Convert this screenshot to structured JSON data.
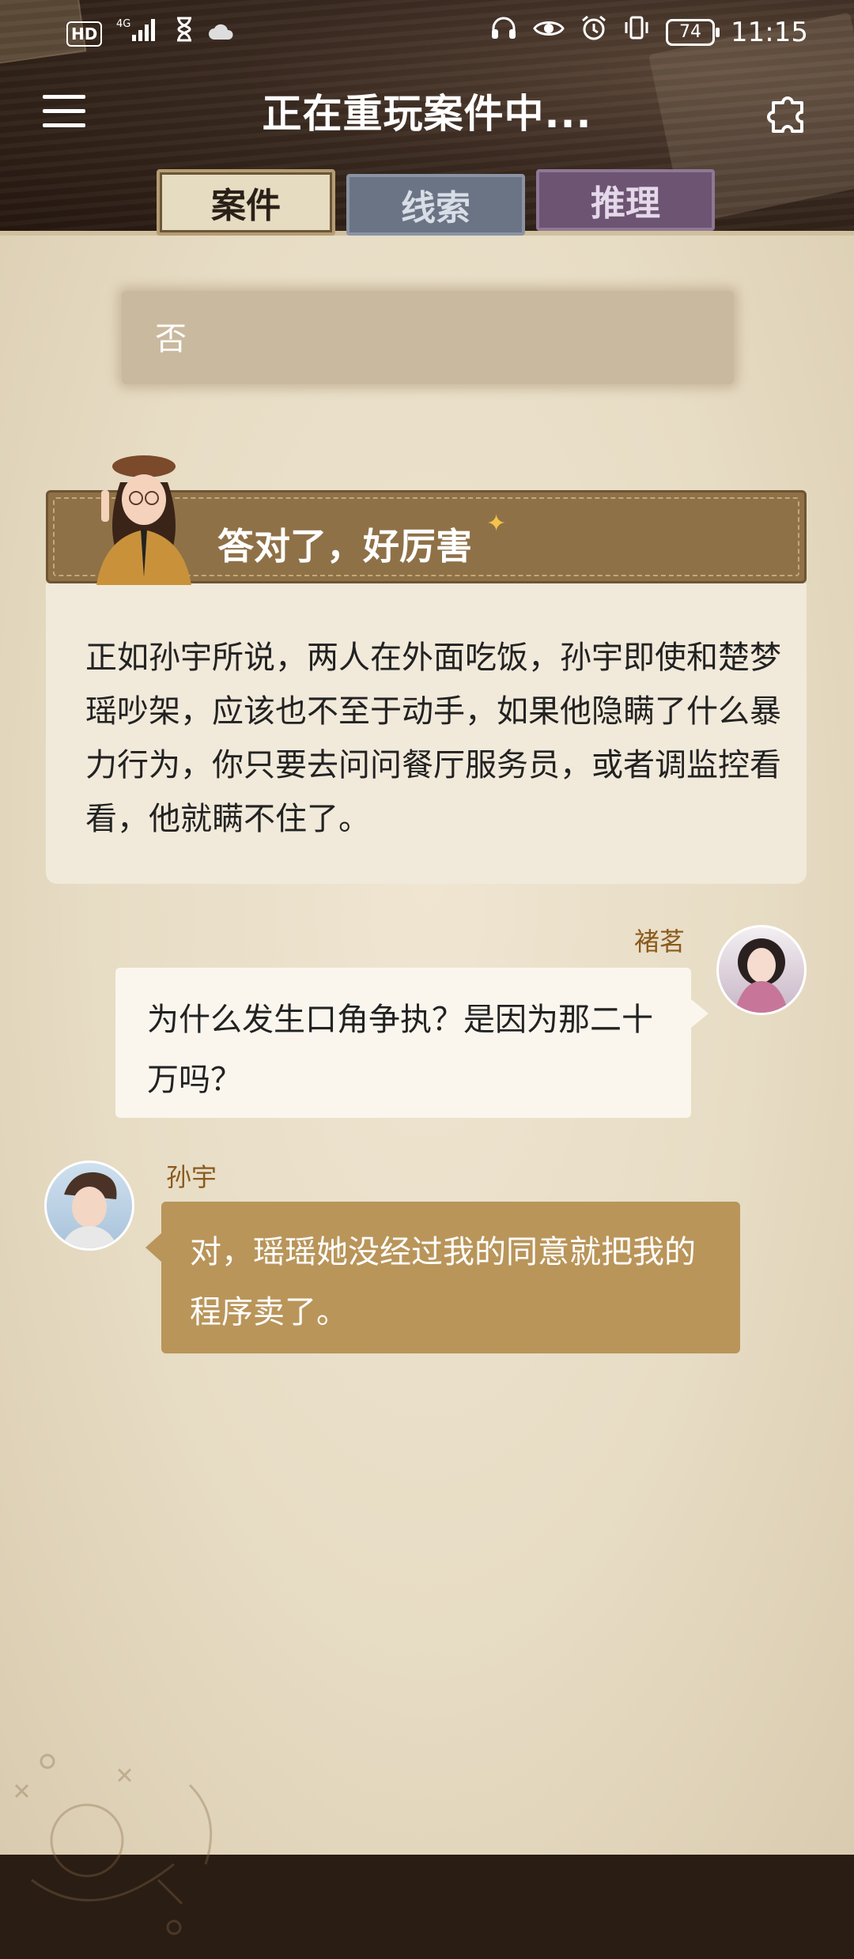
{
  "status_bar": {
    "hd": "HD",
    "network": "4G",
    "time": "11:15",
    "battery": "74",
    "left_icons": [
      "hd-icon",
      "signal-icon",
      "hourglass-icon",
      "cloud-icon"
    ],
    "right_icons": [
      "headphones-icon",
      "eye-icon",
      "alarm-icon",
      "vibrate-icon",
      "battery-icon"
    ]
  },
  "header": {
    "title": "正在重玩案件中...",
    "menu_icon": "menu-icon",
    "puzzle_icon": "puzzle-icon"
  },
  "tabs": [
    {
      "label": "案件",
      "active": true
    },
    {
      "label": "线索",
      "active": false
    },
    {
      "label": "推理",
      "active": false
    }
  ],
  "answer": {
    "text": "否"
  },
  "result": {
    "title": "答对了，好厉害",
    "body": "正如孙宇所说，两人在外面吃饭，孙宇即使和楚梦瑶吵架，应该也不至于动手，如果他隐瞒了什么暴力行为，你只要去问问餐厅服务员，或者调监控看看，他就瞒不住了。"
  },
  "chat": [
    {
      "speaker": "褚茗",
      "text": "为什么发生口角争执？是因为那二十万吗？",
      "side": "right"
    },
    {
      "speaker": "孙宇",
      "text": "对，瑶瑶她没经过我的同意就把我的程序卖了。",
      "side": "left"
    }
  ],
  "colors": {
    "parchment": "#e9dfca",
    "gold_bubble": "#b9955a",
    "speaker_name": "#8a5a1e",
    "result_header": "#8f7148"
  }
}
